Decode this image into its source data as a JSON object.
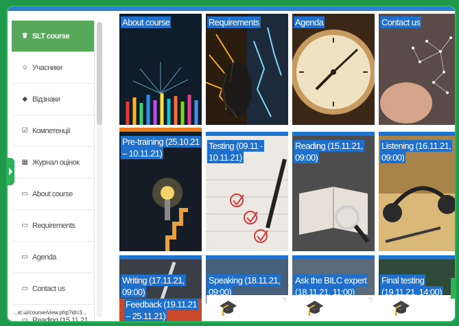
{
  "sidebar": {
    "items": [
      {
        "icon": "graduation-cap-icon",
        "glyph": "♛",
        "label": "SLT course",
        "active": true
      },
      {
        "icon": "users-icon",
        "glyph": "☺",
        "label": "Учасники"
      },
      {
        "icon": "badge-icon",
        "glyph": "◆",
        "label": "Відзнаки"
      },
      {
        "icon": "checkbox-icon",
        "glyph": "☑",
        "label": "Компетенції"
      },
      {
        "icon": "grades-icon",
        "glyph": "▦",
        "label": "Журнал оцінок"
      },
      {
        "icon": "folder-icon",
        "glyph": "▭",
        "label": "About course"
      },
      {
        "icon": "folder-icon",
        "glyph": "▭",
        "label": "Requirements"
      },
      {
        "icon": "folder-icon",
        "glyph": "▭",
        "label": "Agenda"
      },
      {
        "icon": "folder-icon",
        "glyph": "▭",
        "label": "Contact us"
      },
      {
        "icon": "folder-icon",
        "glyph": "▭",
        "label": "Reading (15.11.21,"
      }
    ]
  },
  "status_text": "...st.ui/course/view.php?id=3...",
  "tiles": [
    {
      "label": "About course",
      "bg": "#0f1d2b"
    },
    {
      "label": "Requirements",
      "bg": "#3b2a17"
    },
    {
      "label": "Agenda",
      "bg": "#6a4a2a"
    },
    {
      "label": "Contact us",
      "bg": "#6a5a55"
    },
    {
      "label": "Pre-training (25.10.21 – 10.11.21)",
      "bg": "#1b2530"
    },
    {
      "label": "Testing (09.11 - 10.11.21)",
      "bg": "#e9e6e2"
    },
    {
      "label": "Reading (15.11.21, 09:00)",
      "bg": "#5c5c5c"
    },
    {
      "label": "Listening (16.11.21, 09:00)",
      "bg": "#b08a50"
    },
    {
      "label": "Writing (17.11.21, 09:00)",
      "bg": "#3a3f48"
    },
    {
      "label": "Speaking (18.11.21, 09:00)",
      "bg": "#46607a"
    },
    {
      "label": "Ask the BILC expert (18.11.21, 11:00)",
      "bg": "#5a6a78"
    },
    {
      "label": "Final testing (19.11.21, 14:00)",
      "bg": "#2e4a38"
    }
  ],
  "feedback_label": "Feedback (19.11.21 – 25.11.21)",
  "colors": {
    "accent_green": "#2db25a",
    "active_item": "#57a85b",
    "label_blue": "#1f6fcc"
  }
}
